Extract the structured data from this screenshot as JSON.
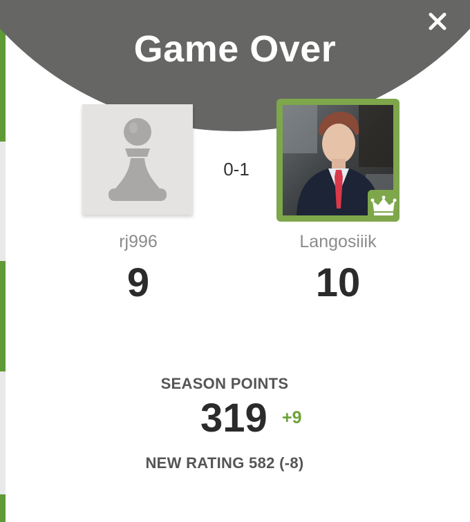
{
  "modal": {
    "title": "Game Over",
    "close_icon": "close-icon"
  },
  "players": {
    "left": {
      "username": "rj996",
      "rating": "9",
      "avatar_icon": "pawn-icon"
    },
    "right": {
      "username": "Langosiiik",
      "rating": "10",
      "avatar_icon": "user-photo",
      "badge_icon": "crown-icon",
      "is_winner": true
    }
  },
  "result": {
    "score": "0-1"
  },
  "season": {
    "label": "SEASON POINTS",
    "points": "319",
    "delta": "+9"
  },
  "new_rating": {
    "label": "NEW RATING",
    "value": "582",
    "change": "(-8)"
  },
  "colors": {
    "header_bg": "#666664",
    "winner_green": "#7ea64b",
    "delta_green": "#6ea23a",
    "text_dark": "#2b2b2b",
    "text_muted": "#8b8b8b"
  }
}
